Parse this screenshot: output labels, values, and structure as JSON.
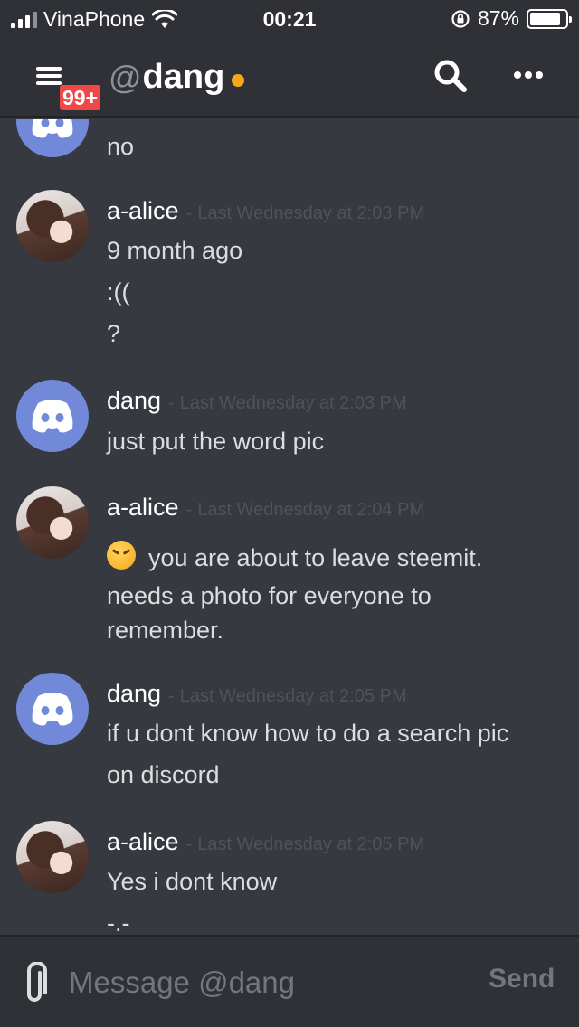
{
  "status_bar": {
    "carrier": "VinaPhone",
    "time": "00:21",
    "battery": "87%",
    "battery_level": 0.87
  },
  "header": {
    "badge": "99+",
    "at": "@",
    "channel": "dang",
    "presence_color": "#faa61a"
  },
  "messages": [
    {
      "author": "",
      "time": "",
      "lines": [
        "no"
      ],
      "avatar": "discord-logo"
    },
    {
      "author": "a-alice",
      "time": "Last Wednesday at 2:03 PM",
      "lines": [
        "9 month ago",
        ":((",
        "?"
      ],
      "avatar": "photo"
    },
    {
      "author": "dang",
      "time": "Last Wednesday at 2:03 PM",
      "lines": [
        "just put the word pic"
      ],
      "avatar": "discord-logo"
    },
    {
      "author": "a-alice",
      "time": "Last Wednesday at 2:04 PM",
      "lines": [
        "you are about to leave steemit.",
        "needs a photo for everyone to",
        "remember."
      ],
      "avatar": "photo",
      "emoji": "persevering-face"
    },
    {
      "author": "dang",
      "time": "Last Wednesday at 2:05 PM",
      "lines": [
        "if u dont know how to do a search pic",
        "on discord"
      ],
      "avatar": "discord-logo"
    },
    {
      "author": "a-alice",
      "time": "Last Wednesday at 2:05 PM",
      "lines": [
        "Yes i dont know",
        "-.-"
      ],
      "avatar": "photo"
    }
  ],
  "composer": {
    "placeholder": "Message @dang",
    "send_label": "Send"
  },
  "colors": {
    "background": "#36393f",
    "blurple": "#7289da",
    "badge": "#f04747"
  }
}
